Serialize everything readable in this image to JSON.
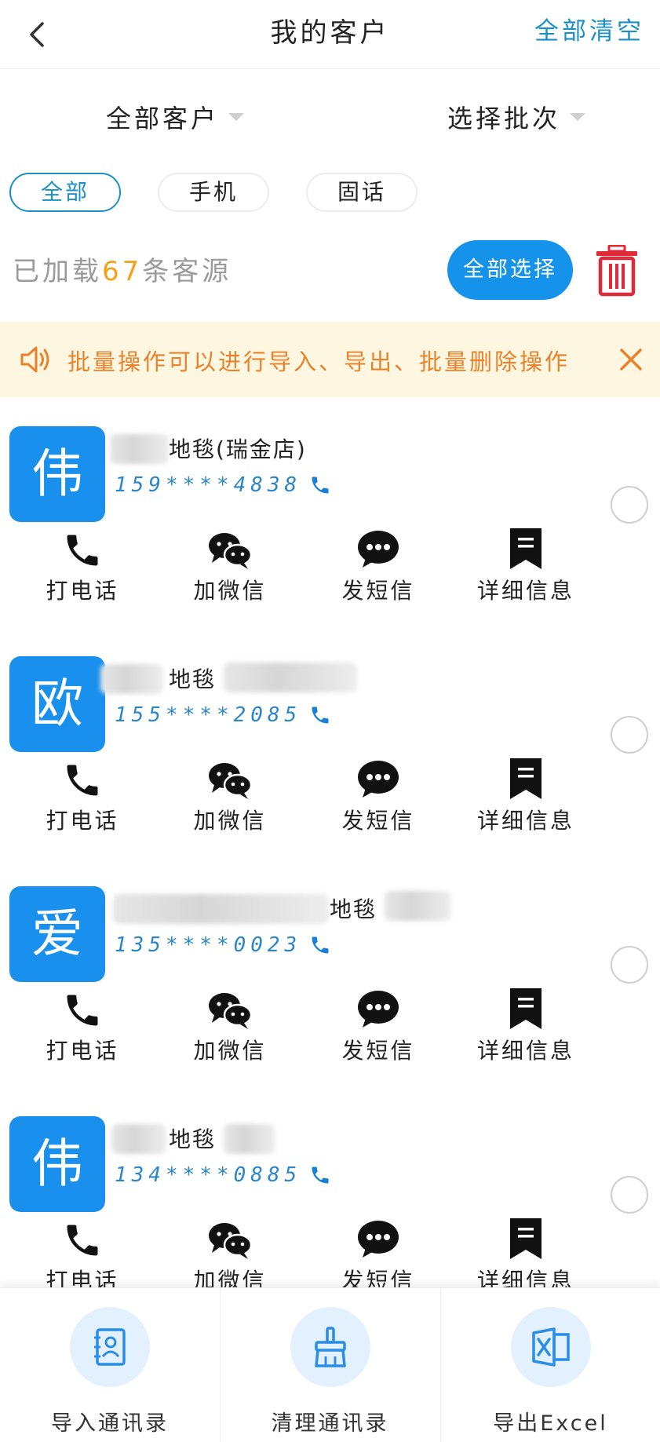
{
  "header": {
    "title": "我的客户",
    "clear_all": "全部清空"
  },
  "filters": {
    "customer_dropdown": "全部客户",
    "batch_dropdown": "选择批次"
  },
  "type_tabs": [
    {
      "label": "全部",
      "active": true
    },
    {
      "label": "手机",
      "active": false
    },
    {
      "label": "固话",
      "active": false
    }
  ],
  "status": {
    "prefix": "已加载",
    "count": "67",
    "suffix": "条客源",
    "select_all": "全部选择"
  },
  "notice": {
    "text": "批量操作可以进行导入、导出、批量删除操作"
  },
  "actions": {
    "call": "打电话",
    "wechat": "加微信",
    "sms": "发短信",
    "details": "详细信息"
  },
  "customers": [
    {
      "avatar": "伟",
      "name": "地毯(瑞金店)",
      "phone": "159****4838"
    },
    {
      "avatar": "欧",
      "name": "地毯",
      "phone": "155****2085"
    },
    {
      "avatar": "爱",
      "name": "地毯",
      "phone": "135****0023"
    },
    {
      "avatar": "伟",
      "name": "地毯",
      "phone": "134****0885"
    }
  ],
  "bottom_bar": {
    "import": "导入通讯录",
    "clean": "清理通讯录",
    "export": "导出Excel"
  },
  "colors": {
    "accent": "#1593ea",
    "link": "#1a90c8",
    "notice_text": "#e9822a",
    "notice_bg": "#fdf7e2",
    "count_highlight": "#f3a21a",
    "trash": "#e02a3a"
  }
}
